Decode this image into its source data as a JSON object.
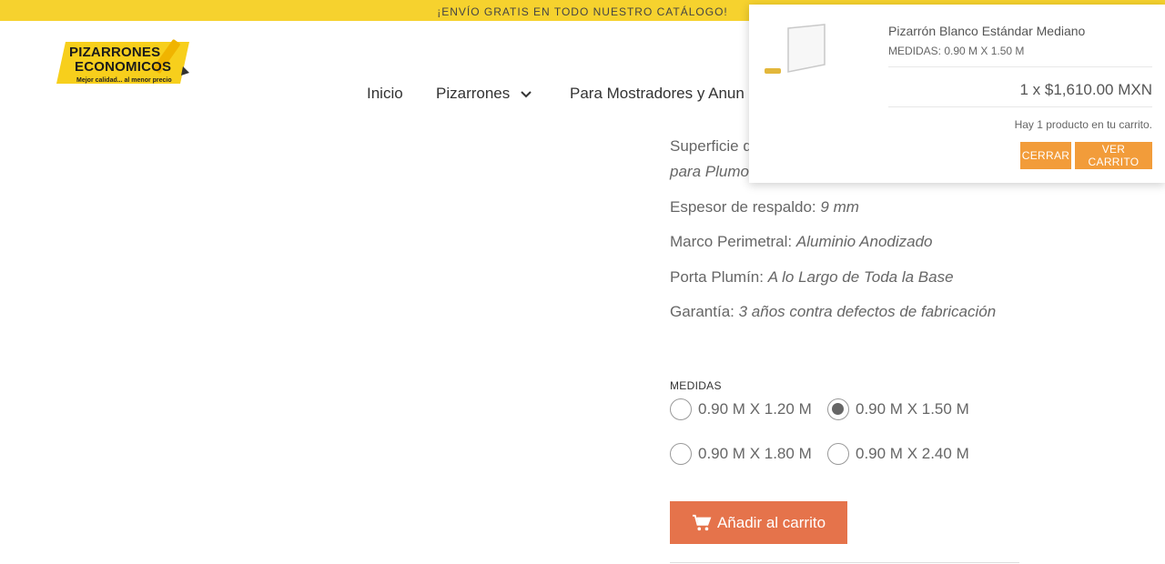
{
  "promo": {
    "text": "¡ENVÍO GRATIS EN TODO NUESTRO CATÁLOGO!"
  },
  "colors": {
    "promo_bg": "#f6d22e",
    "add_to_cart_bg": "#e5734b",
    "minicart_button_bg": "#f29c3a"
  },
  "logo": {
    "line1": "PIZARRONES",
    "line2": "ECONOMICOS",
    "tagline": "Mejor calidad... al menor precio"
  },
  "nav": {
    "items": [
      {
        "label": "Inicio"
      },
      {
        "label": "Pizarrones",
        "icon": "chevron-down-icon"
      },
      {
        "label": "Para Mostradores y Anun"
      }
    ]
  },
  "product": {
    "specs": [
      {
        "label": "Superficie d",
        "value": ""
      },
      {
        "label": "",
        "value": "para Plumo"
      },
      {
        "label": "Espesor de respaldo: ",
        "value": "9 mm"
      },
      {
        "label": "Marco Perimetral: ",
        "value": "Aluminio Anodizado"
      },
      {
        "label": "Porta Plumín: ",
        "value": "A lo Largo de Toda la Base"
      },
      {
        "label": "Garantía: ",
        "value": "3 años contra defectos de fabricación"
      }
    ],
    "medidas_label": "MEDIDAS",
    "options": [
      {
        "label": "0.90 M X 1.20 M",
        "selected": false
      },
      {
        "label": "0.90 M X 1.50 M",
        "selected": true
      },
      {
        "label": "0.90 M X 1.80 M",
        "selected": false
      },
      {
        "label": "0.90 M X 2.40 M",
        "selected": false
      }
    ],
    "add_to_cart_label": "Añadir al carrito",
    "add_to_cart_icon": "cart-icon"
  },
  "minicart": {
    "item_title": "Pizarrón Blanco Estándar Mediano",
    "item_variant": "MEDIDAS: 0.90 M X 1.50 M",
    "quantity_line": "1 x $1,610.00 MXN",
    "count_text": "Hay 1 producto en tu carrito.",
    "close_label": "CERRAR",
    "view_cart_label": "VER CARRITO"
  }
}
